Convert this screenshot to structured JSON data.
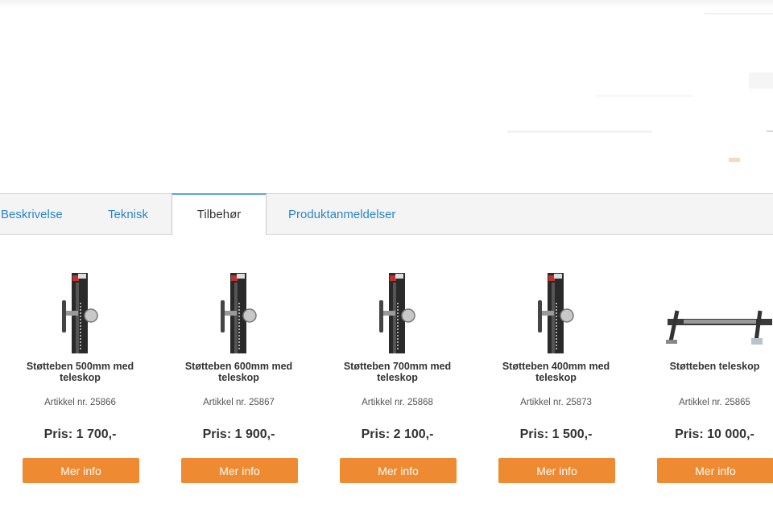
{
  "tabs": [
    {
      "label": "Beskrivelse",
      "active": false
    },
    {
      "label": "Teknisk",
      "active": false
    },
    {
      "label": "Tilbehør",
      "active": true
    },
    {
      "label": "Produktanmeldelser",
      "active": false
    }
  ],
  "products": [
    {
      "name": "Støtteben 500mm med teleskop",
      "article": "Artikkel nr. 25866",
      "price": "Pris: 1 700,-",
      "button": "Mer info",
      "image": "jack-stand-icon"
    },
    {
      "name": "Støtteben 600mm med teleskop",
      "article": "Artikkel nr. 25867",
      "price": "Pris: 1 900,-",
      "button": "Mer info",
      "image": "jack-stand-icon"
    },
    {
      "name": "Støtteben 700mm med teleskop",
      "article": "Artikkel nr. 25868",
      "price": "Pris: 2 100,-",
      "button": "Mer info",
      "image": "jack-stand-icon"
    },
    {
      "name": "Støtteben 400mm med teleskop",
      "article": "Artikkel nr. 25873",
      "price": "Pris: 1 500,-",
      "button": "Mer info",
      "image": "jack-stand-icon"
    },
    {
      "name": "Støtteben teleskop",
      "article": "Artikkel nr. 25865",
      "price": "Pris: 10 000,-",
      "button": "Mer info",
      "image": "telescopic-leg-bar-icon"
    }
  ],
  "colors": {
    "accent_button": "#ee8a31",
    "tab_link": "#2a86c8",
    "active_tab_border": "#5fa3d9"
  }
}
